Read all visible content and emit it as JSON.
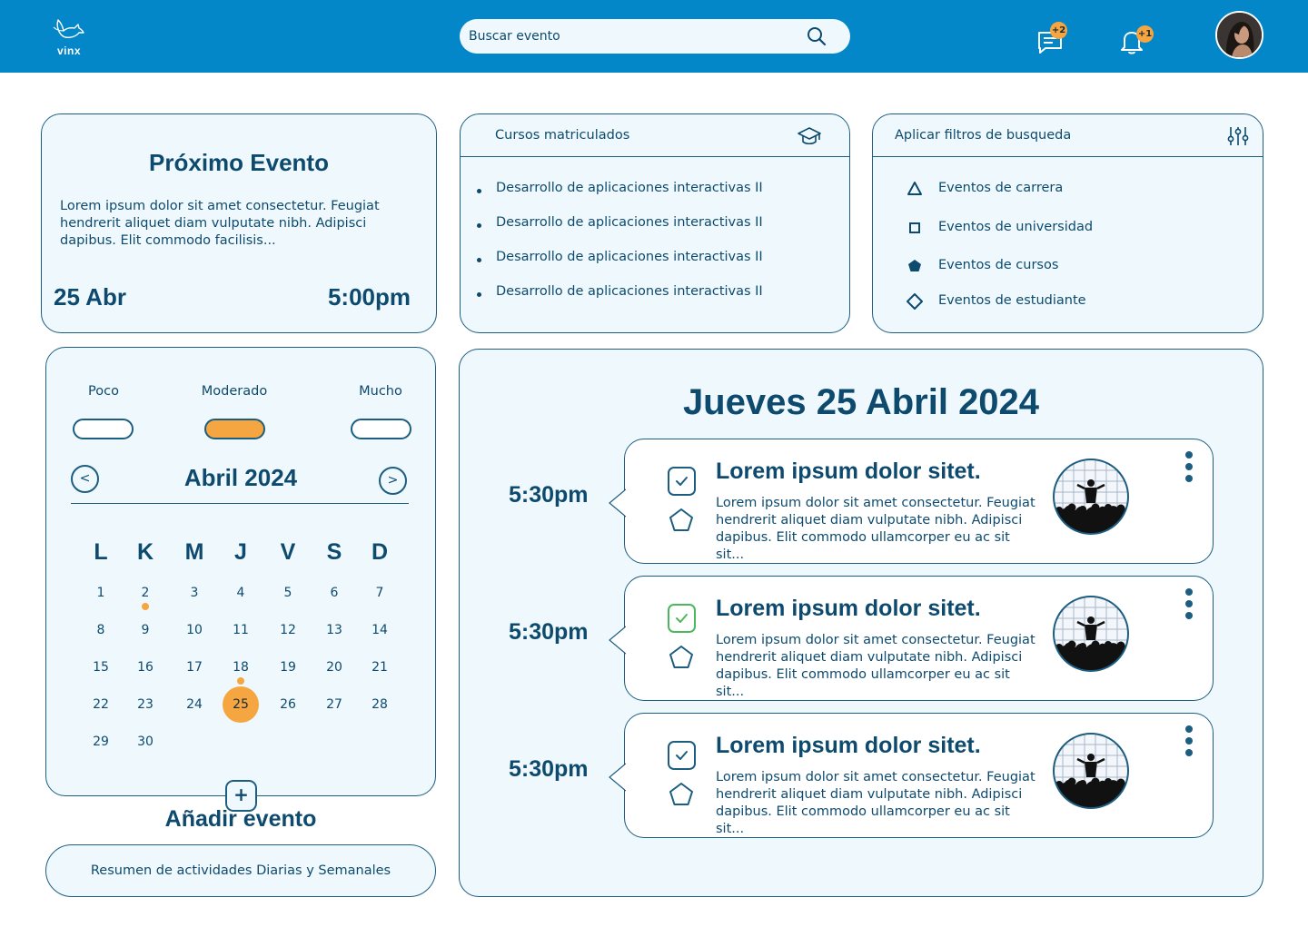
{
  "header": {
    "logo_text": "vinx",
    "search_placeholder": "Buscar evento",
    "messages_badge": "+2",
    "notifications_badge": "+1"
  },
  "next_event": {
    "title": "Próximo Evento",
    "description": "Lorem ipsum dolor sit amet consectetur. Feugiat hendrerit aliquet diam vulputate nibh. Adipisci dapibus. Elit commodo facilisis...",
    "date": "25 Abr",
    "time": "5:00pm"
  },
  "courses": {
    "title": "Cursos matriculados",
    "items": [
      "Desarrollo de aplicaciones interactivas II",
      "Desarrollo de aplicaciones interactivas II",
      "Desarrollo de aplicaciones interactivas II",
      "Desarrollo de aplicaciones interactivas II"
    ]
  },
  "filters": {
    "title": "Aplicar filtros de busqueda",
    "items": [
      {
        "label": "Eventos de carrera",
        "icon": "triangle-icon"
      },
      {
        "label": "Eventos de universidad",
        "icon": "square-icon"
      },
      {
        "label": "Eventos de cursos",
        "icon": "pentagon-filled-icon"
      },
      {
        "label": "Eventos de estudiante",
        "icon": "diamond-icon"
      }
    ]
  },
  "activity_level": {
    "options": [
      "Poco",
      "Moderado",
      "Mucho"
    ],
    "selected": "Moderado"
  },
  "calendar": {
    "month": "Abril 2024",
    "prev": "<",
    "next": ">",
    "weekdays": [
      "L",
      "K",
      "M",
      "J",
      "V",
      "S",
      "D"
    ],
    "days": [
      "1",
      "2",
      "3",
      "4",
      "5",
      "6",
      "7",
      "8",
      "9",
      "10",
      "11",
      "12",
      "13",
      "14",
      "15",
      "16",
      "17",
      "18",
      "19",
      "20",
      "21",
      "22",
      "23",
      "24",
      "25",
      "26",
      "27",
      "28",
      "29",
      "30"
    ],
    "selected_day": "25",
    "marked_days": [
      "2",
      "18"
    ]
  },
  "add_event": {
    "button": "+",
    "label": "Añadir evento"
  },
  "summary_button": "Resumen de actividades Diarias y Semanales",
  "day_view": {
    "title": "Jueves 25 Abril 2024",
    "events": [
      {
        "time": "5:30pm",
        "title": "Lorem ipsum dolor sitet.",
        "description": "Lorem ipsum dolor sit amet consectetur. Feugiat hendrerit aliquet diam vulputate nibh. Adipisci dapibus. Elit commodo ullamcorper eu ac sit sit...",
        "check_color": "#1c5d80"
      },
      {
        "time": "5:30pm",
        "title": "Lorem ipsum dolor sitet.",
        "description": "Lorem ipsum dolor sit amet consectetur. Feugiat hendrerit aliquet diam vulputate nibh. Adipisci dapibus. Elit commodo ullamcorper eu ac sit sit...",
        "check_color": "#4cb85c"
      },
      {
        "time": "5:30pm",
        "title": "Lorem ipsum dolor sitet.",
        "description": "Lorem ipsum dolor sit amet consectetur. Feugiat hendrerit aliquet diam vulputate nibh. Adipisci dapibus. Elit commodo ullamcorper eu ac sit sit...",
        "check_color": "#1c5d80"
      }
    ]
  },
  "colors": {
    "header_bg": "#0387c9",
    "panel_bg": "#eff9fd",
    "primary_text": "#0d4a6e",
    "accent": "#f5a641",
    "border": "#1c5d80"
  }
}
